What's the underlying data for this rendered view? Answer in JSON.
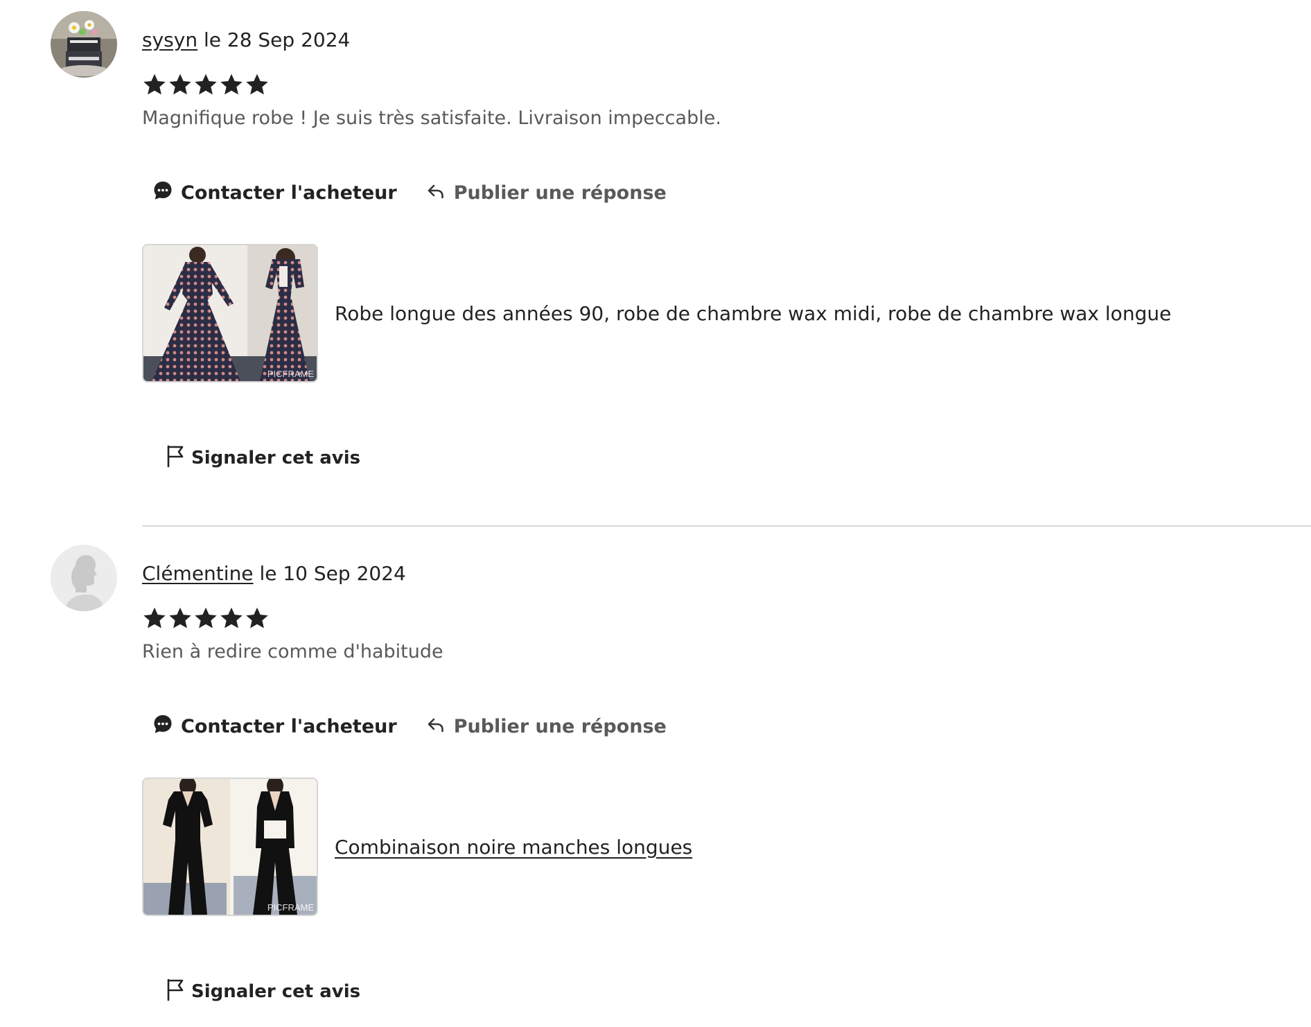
{
  "reviews": [
    {
      "author": "sysyn",
      "date_text": "le 28 Sep 2024",
      "rating": 5,
      "text": "Magnifique robe ! Je suis très satisfaite. Livraison impeccable.",
      "contact_label": "Contacter l'acheteur",
      "reply_label": "Publier une réponse",
      "product_title": "Robe longue des années 90, robe de chambre wax midi, robe de chambre wax longue",
      "thumb_watermark": "PICFRAME",
      "report_label": "Signaler cet avis",
      "avatar_icon": "cake-photo-avatar"
    },
    {
      "author": "Clémentine",
      "date_text": "le 10 Sep 2024",
      "rating": 5,
      "text": "Rien à redire comme d'habitude",
      "contact_label": "Contacter l'acheteur",
      "reply_label": "Publier une réponse",
      "product_title": "Combinaison noire manches longues",
      "thumb_watermark": "PICFRAME",
      "report_label": "Signaler cet avis",
      "avatar_icon": "default-person-avatar"
    }
  ],
  "colors": {
    "text_primary": "#222222",
    "text_secondary": "#595959",
    "divider": "#d9d9d9"
  }
}
